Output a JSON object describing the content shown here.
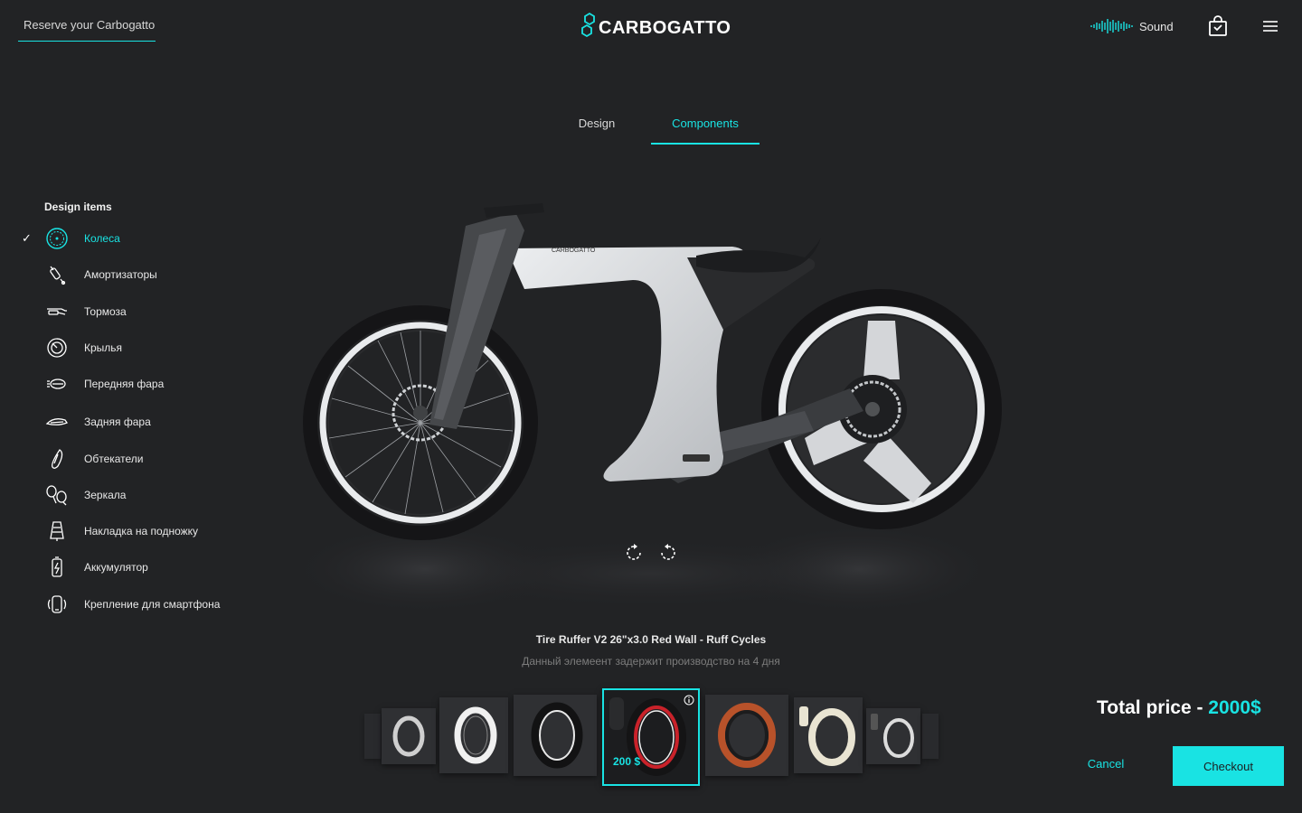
{
  "header": {
    "reserve_label": "Reserve your Carbogatto",
    "logo_text": "CARBOGATTO",
    "sound_label": "Sound"
  },
  "tabs": [
    {
      "label": "Design",
      "active": false
    },
    {
      "label": "Components",
      "active": true
    }
  ],
  "sidebar": {
    "title": "Design items",
    "items": [
      {
        "label": "Колеса",
        "icon": "wheel-icon",
        "selected": true
      },
      {
        "label": "Амортизаторы",
        "icon": "shock-absorber-icon",
        "selected": false
      },
      {
        "label": "Тормоза",
        "icon": "brake-icon",
        "selected": false
      },
      {
        "label": "Крылья",
        "icon": "fender-icon",
        "selected": false
      },
      {
        "label": "Передняя фара",
        "icon": "headlight-icon",
        "selected": false
      },
      {
        "label": "Задняя фара",
        "icon": "taillight-icon",
        "selected": false
      },
      {
        "label": "Обтекатели",
        "icon": "fairing-icon",
        "selected": false
      },
      {
        "label": "Зеркала",
        "icon": "mirror-icon",
        "selected": false
      },
      {
        "label": "Накладка на подножку",
        "icon": "footrest-pad-icon",
        "selected": false
      },
      {
        "label": "Аккумулятор",
        "icon": "battery-icon",
        "selected": false
      },
      {
        "label": "Крепление для смартфона",
        "icon": "phone-mount-icon",
        "selected": false
      }
    ]
  },
  "bike": {
    "frame_text": "CARBOGATTO"
  },
  "product": {
    "name": "Tire Ruffer V2 26\"x3.0 Red Wall - Ruff Cycles",
    "delay_note": "Данный элемеент задержит производство на 4 дня"
  },
  "carousel": {
    "selected_index": 4,
    "selected_price": "200 $"
  },
  "footer": {
    "total_label": "Total price - ",
    "total_value": "2000$",
    "cancel_label": "Cancel",
    "checkout_label": "Checkout"
  },
  "colors": {
    "accent": "#19e3e3",
    "background": "#222325",
    "frame": "#d9dbde"
  }
}
